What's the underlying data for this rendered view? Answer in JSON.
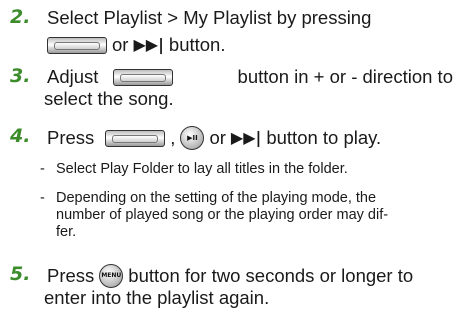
{
  "steps": [
    {
      "number": "2.",
      "text_a": "Select Playlist > My Playlist by pressing",
      "text_b": "or",
      "icon_b": "play-next-icon",
      "text_c": "button."
    },
    {
      "number": "3.",
      "text_a": "Adjust",
      "text_b": "button in + or - direction to",
      "text_c": "select the song."
    },
    {
      "number": "4.",
      "text_a": "Press",
      "text_b": ",",
      "text_c": "or",
      "text_d": "button to play.",
      "play_pause_label": "▶II",
      "notes": [
        "Select Play Folder to lay all titles in the folder.",
        "Depending on the setting of the playing mode, the",
        "number of played song or the playing order may dif-",
        "fer."
      ]
    },
    {
      "number": "5.",
      "text_a": "Press",
      "menu_label": "MENU",
      "text_b": "button for two seconds or longer to",
      "text_c": "enter into the playlist again."
    }
  ],
  "colors": {
    "step_number": "#3d8c2c",
    "text": "#1a1a1a"
  },
  "glyphs": {
    "next": "▶▶|",
    "dash": "-"
  }
}
